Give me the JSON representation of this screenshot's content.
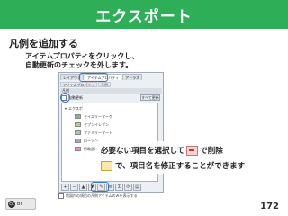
{
  "title": "エクスポート",
  "heading": "凡例を追加する",
  "instructions": {
    "line1": "アイテムプロパティをクリックし、",
    "line2": "自動更新のチェックを外します。"
  },
  "window": {
    "tabs": [
      "レイアウト",
      "アイテムプロパティ",
      "アトラス"
    ],
    "subtabs": [
      "アイテムプロパティ",
      "凡例"
    ],
    "section_label": "凡例",
    "auto_update_label": "自動更新",
    "side_button_label": "すべて更新",
    "root_label": "エクスポ",
    "legend_items": [
      {
        "label": "セイエリーマーケ",
        "color": "#79c86d"
      },
      {
        "label": "セプンイレブン",
        "color": "#b8d27a"
      },
      {
        "label": "ファミリーマート",
        "color": "#8fd3c7"
      },
      {
        "label": "ローソン",
        "color": "#a5a0da"
      },
      {
        "label": "行政区域",
        "color": "#e58fd7"
      }
    ],
    "toolbar": [
      "+",
      "−",
      "▲",
      "▼",
      "✎",
      "≡",
      "Σ",
      "⟳",
      "▤"
    ],
    "bottom_note": "地図内の項目の凡例アイテムのみを表示する"
  },
  "callout": {
    "line1_prefix": "必要ない項目を選択して",
    "line1_suffix": "で削除",
    "line2": "で、項目名を修正することができます"
  },
  "license": {
    "badge": "cc",
    "text": "BY"
  },
  "page_number": "172"
}
